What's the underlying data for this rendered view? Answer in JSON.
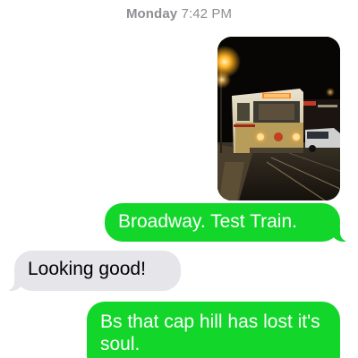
{
  "conversation": {
    "timestamp_day": "Monday",
    "timestamp_time": "7:42 PM",
    "messages": [
      {
        "type": "photo",
        "direction": "sent",
        "subject": "streetcar-at-night-photo"
      },
      {
        "type": "text",
        "direction": "sent",
        "text": "Broadway. Test Train."
      },
      {
        "type": "text",
        "direction": "received",
        "text": "Looking good!"
      },
      {
        "type": "text",
        "direction": "sent",
        "text": "Bs that cap hill has lost it's soul."
      }
    ]
  },
  "colors": {
    "sent_bubble": "#12d62a",
    "received_bubble": "#e5e5ea",
    "timestamp": "#8e8e93"
  }
}
